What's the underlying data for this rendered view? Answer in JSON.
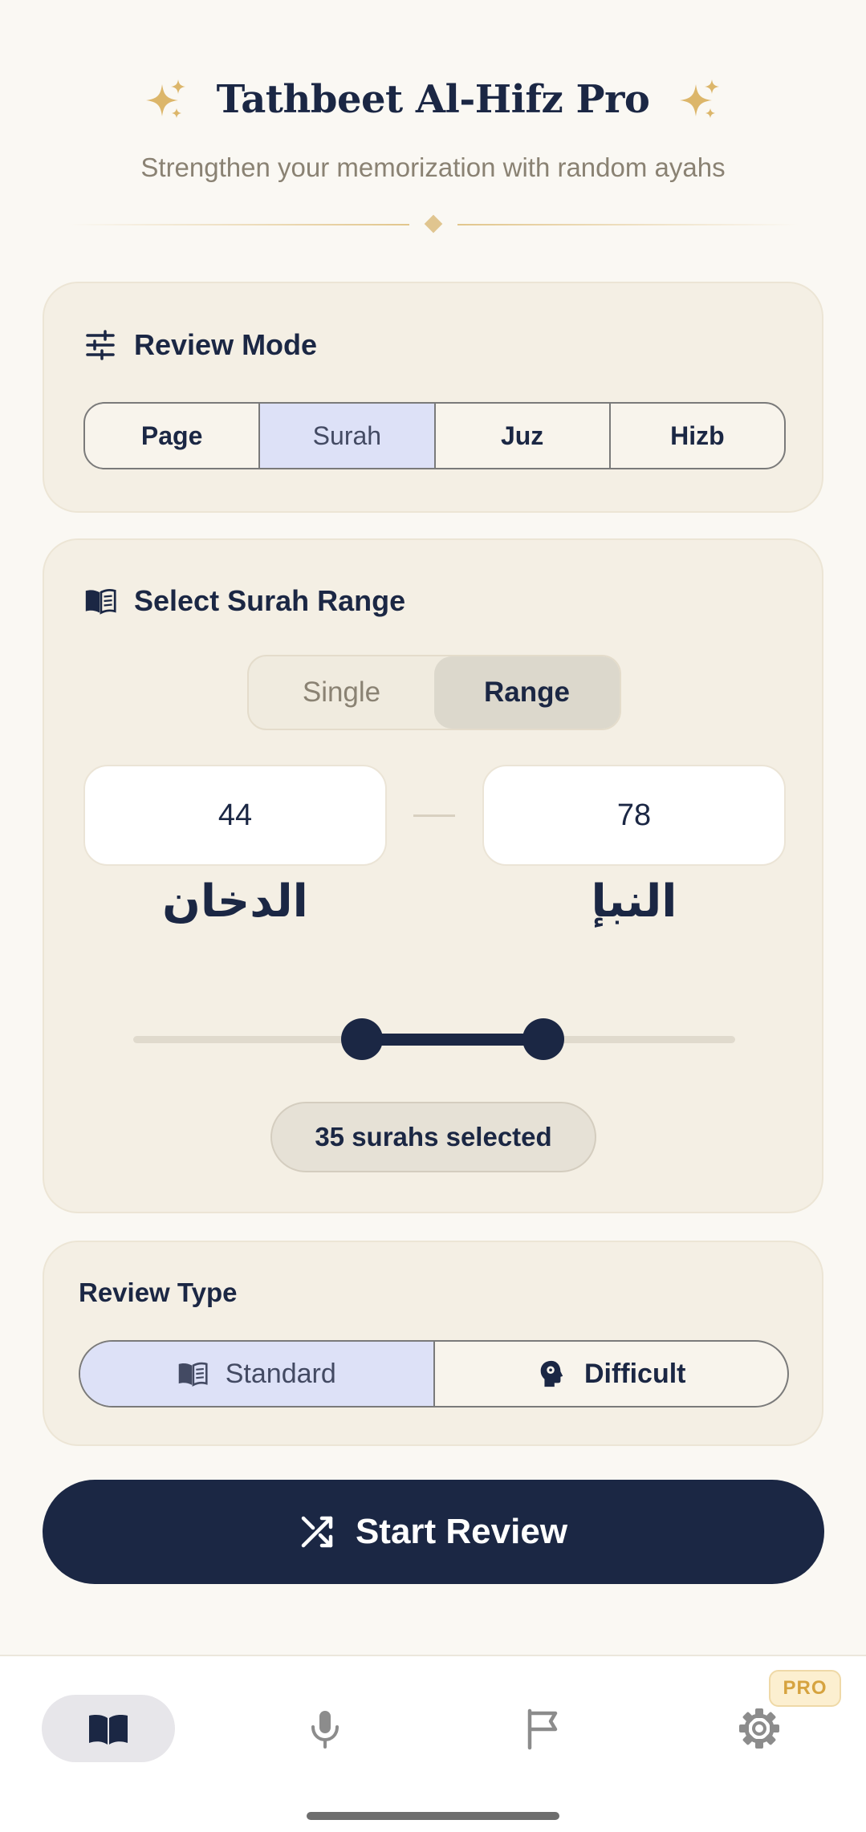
{
  "header": {
    "title": "Tathbeet Al-Hifz Pro",
    "subtitle": "Strengthen your memorization with random ayahs",
    "accent_color": "#d8b46e"
  },
  "review_mode": {
    "title": "Review Mode",
    "icon": "sliders-icon",
    "options": [
      "Page",
      "Surah",
      "Juz",
      "Hizb"
    ],
    "selected": "Surah"
  },
  "surah_range": {
    "title": "Select Surah Range",
    "icon": "open-book-icon",
    "toggle": {
      "single_label": "Single",
      "range_label": "Range",
      "selected": "Range"
    },
    "from": {
      "number": "44",
      "name": "الدخان"
    },
    "to": {
      "number": "78",
      "name": "النبإ"
    },
    "slider": {
      "min": 1,
      "max": 114,
      "low": 44,
      "high": 78
    },
    "count_label": "35 surahs selected"
  },
  "review_type": {
    "title": "Review Type",
    "standard_label": "Standard",
    "standard_icon": "book-icon",
    "difficult_label": "Difficult",
    "difficult_icon": "brain-head-icon",
    "selected": "Standard"
  },
  "start_button": {
    "label": "Start Review",
    "icon": "shuffle-icon"
  },
  "bottom_nav": {
    "items": [
      {
        "icon": "book-icon",
        "active": true
      },
      {
        "icon": "microphone-icon",
        "active": false
      },
      {
        "icon": "flag-icon",
        "active": false
      },
      {
        "icon": "gear-icon",
        "active": false
      }
    ],
    "pro_badge": "PRO"
  },
  "colors": {
    "primary": "#1b2744",
    "background": "#faf8f3",
    "card": "#f4efe4",
    "selected_segment": "#dde1f7",
    "muted_text": "#8a8273",
    "pro_badge": "#d6a33f"
  }
}
